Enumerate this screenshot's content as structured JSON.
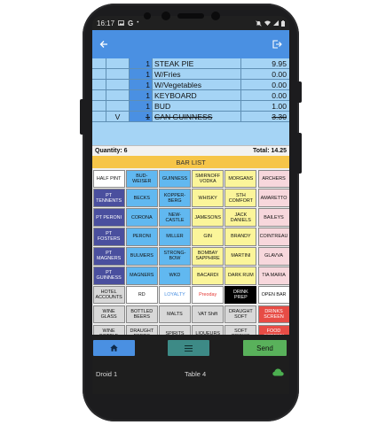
{
  "status": {
    "time": "16:17"
  },
  "order": [
    {
      "mark": "",
      "qty": "1",
      "item": "STEAK PIE",
      "price": "9.95",
      "strike": false
    },
    {
      "mark": "",
      "qty": "1",
      "item": "W/Fries",
      "price": "0.00",
      "strike": false
    },
    {
      "mark": "",
      "qty": "1",
      "item": "W/Vegetables",
      "price": "0.00",
      "strike": false
    },
    {
      "mark": "",
      "qty": "1",
      "item": "KEYBOARD",
      "price": "0.00",
      "strike": false
    },
    {
      "mark": "",
      "qty": "1",
      "item": "BUD",
      "price": "1.00",
      "strike": false
    },
    {
      "mark": "V",
      "qty": "1",
      "item": "CAN GUINNESS",
      "price": "3.30",
      "strike": true
    }
  ],
  "totals": {
    "quantity": "Quantity: 6",
    "total": "Total: 14.25"
  },
  "section": {
    "title": "BAR LIST"
  },
  "colors": {
    "white": "#ffffff",
    "blue": "#61b8f0",
    "navy": "#4a4f9e",
    "yellow": "#fbf59a",
    "pink": "#f7d7dc",
    "black": "#000000",
    "red": "#e74c45",
    "gray": "#d8d8d8"
  },
  "grid": [
    {
      "label": "HALF PINT",
      "color": "white"
    },
    {
      "label": "BUD-WEISER",
      "color": "blue"
    },
    {
      "label": "GUINNESS",
      "color": "blue"
    },
    {
      "label": "SMIRNOFF VODKA",
      "color": "yellow"
    },
    {
      "label": "MORGANS",
      "color": "yellow"
    },
    {
      "label": "ARCHERS",
      "color": "pink"
    },
    {
      "label": "PT TENNENTS",
      "color": "navy"
    },
    {
      "label": "BECKS",
      "color": "blue"
    },
    {
      "label": "KOPPER-BERG",
      "color": "blue"
    },
    {
      "label": "WHISKY",
      "color": "yellow"
    },
    {
      "label": "STH COMFORT",
      "color": "yellow"
    },
    {
      "label": "AMARETTO",
      "color": "pink"
    },
    {
      "label": "PT PERONI",
      "color": "navy"
    },
    {
      "label": "CORONA",
      "color": "blue"
    },
    {
      "label": "NEW-CASTLE",
      "color": "blue"
    },
    {
      "label": "JAMESONS",
      "color": "yellow"
    },
    {
      "label": "JACK DANIELS",
      "color": "yellow"
    },
    {
      "label": "BAILEYS",
      "color": "pink"
    },
    {
      "label": "PT FOSTERS",
      "color": "navy"
    },
    {
      "label": "PERONI",
      "color": "blue"
    },
    {
      "label": "MILLER",
      "color": "blue"
    },
    {
      "label": "GIN",
      "color": "yellow"
    },
    {
      "label": "BRANDY",
      "color": "yellow"
    },
    {
      "label": "COINTREAU",
      "color": "pink"
    },
    {
      "label": "PT MAGNERS",
      "color": "navy"
    },
    {
      "label": "BULMERS",
      "color": "blue"
    },
    {
      "label": "STRONG-BOW",
      "color": "blue"
    },
    {
      "label": "BOMBAY SAPPHIRE",
      "color": "yellow"
    },
    {
      "label": "MARTINI",
      "color": "yellow"
    },
    {
      "label": "GLAVVA",
      "color": "pink"
    },
    {
      "label": "PT GUINNESS",
      "color": "navy"
    },
    {
      "label": "MAGNERS",
      "color": "blue"
    },
    {
      "label": "WKD",
      "color": "blue"
    },
    {
      "label": "BACARDI",
      "color": "yellow"
    },
    {
      "label": "DARK RUM",
      "color": "yellow"
    },
    {
      "label": "TIA MARIA",
      "color": "pink"
    },
    {
      "label": "HOTEL ACCOUNTS",
      "color": "gray"
    },
    {
      "label": "RD",
      "color": "white"
    },
    {
      "label": "LOYALTY",
      "color": "white",
      "text": "#4a90e2"
    },
    {
      "label": "Preoday",
      "color": "white",
      "text": "#e53935"
    },
    {
      "label": "DRINK PREP",
      "color": "black",
      "text": "#ffffff"
    },
    {
      "label": "OPEN BAR",
      "color": "white"
    },
    {
      "label": "WINE GLASS",
      "color": "gray"
    },
    {
      "label": "BOTTLED BEERS",
      "color": "gray"
    },
    {
      "label": "MALTS",
      "color": "gray"
    },
    {
      "label": "VAT Shift",
      "color": "gray"
    },
    {
      "label": "DRAUGHT SOFT",
      "color": "gray"
    },
    {
      "label": "DRINKS SCREEN",
      "color": "red",
      "text": "#ffffff"
    },
    {
      "label": "WINE BOTTLE",
      "color": "gray"
    },
    {
      "label": "DRAUGHT BEERS",
      "color": "gray"
    },
    {
      "label": "SPIRITS",
      "color": "gray"
    },
    {
      "label": "LIQUEURS",
      "color": "gray"
    },
    {
      "label": "SOFT DRINKS",
      "color": "gray"
    },
    {
      "label": "FOOD SCREEN",
      "color": "red",
      "text": "#ffffff"
    }
  ],
  "actions": {
    "send": "Send"
  },
  "footer": {
    "device": "Droid 1",
    "table": "Table 4"
  },
  "icons": {
    "back": "arrow-left-icon",
    "logout": "logout-icon",
    "home": "home-icon",
    "menu": "menu-icon",
    "cloud": "cloud-icon"
  }
}
